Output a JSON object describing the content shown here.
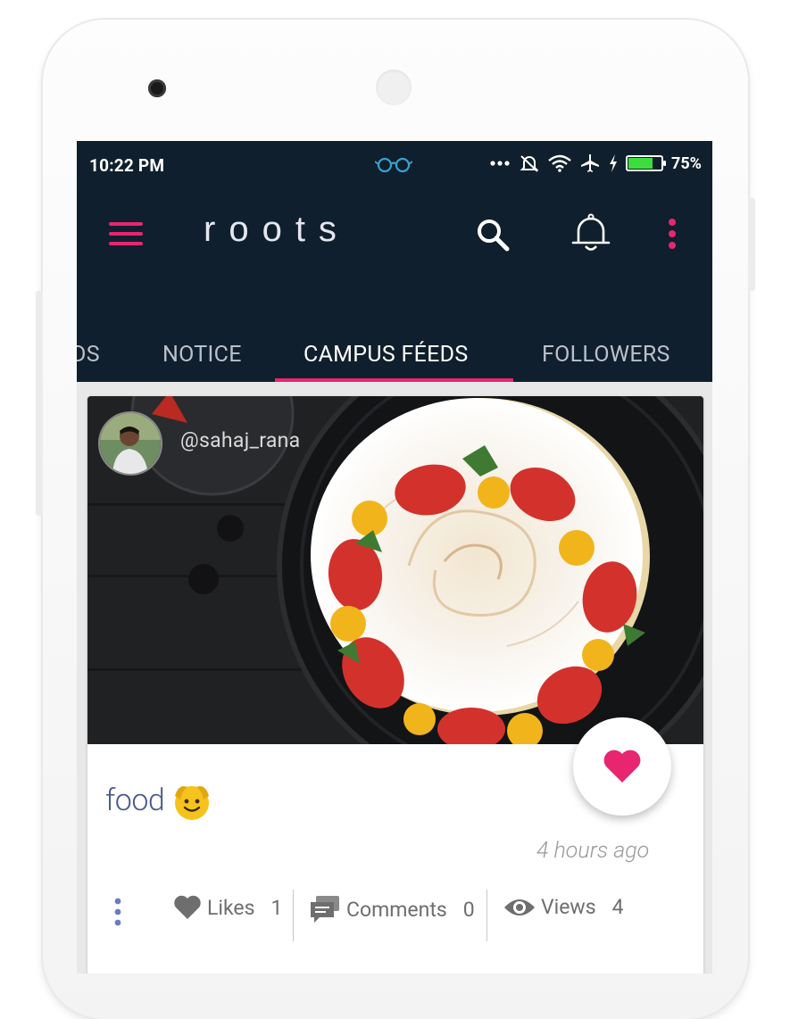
{
  "status_bar": {
    "time": "10:22 PM",
    "battery_percent": "75%",
    "battery_level": 0.75
  },
  "app": {
    "brand": "roots",
    "accent_color": "#e8266f",
    "bar_color": "#0f1f2d"
  },
  "icons": {
    "menu": "hamburger-menu-icon",
    "search": "search-icon",
    "notifications": "bell-icon",
    "overflow": "more-vert-icon"
  },
  "tabs": [
    {
      "label": "DS",
      "active": false
    },
    {
      "label": "NOTICE",
      "active": false
    },
    {
      "label": "CAMPUS FÉEDS",
      "active": true
    },
    {
      "label": "FOLLOWERS",
      "active": false
    }
  ],
  "post": {
    "username": "@sahaj_rana",
    "caption": "food",
    "time_ago": "4 hours ago",
    "likes_label": "Likes",
    "likes_count": "1",
    "comments_label": "Comments",
    "comments_count": "0",
    "views_label": "Views",
    "views_count": "4"
  }
}
